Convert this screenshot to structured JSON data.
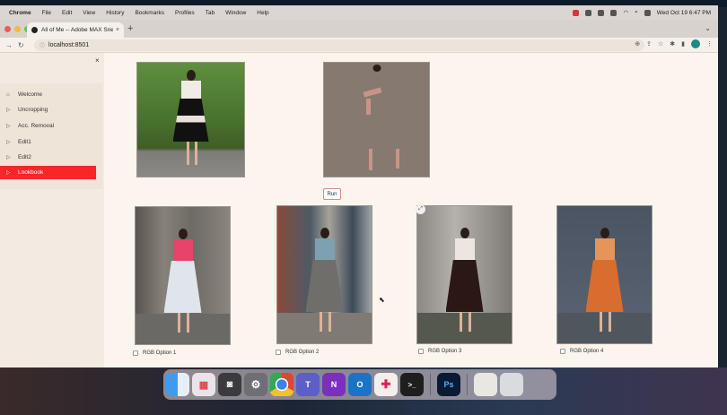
{
  "menubar": {
    "app_name": "Chrome",
    "items": [
      "File",
      "Edit",
      "View",
      "History",
      "Bookmarks",
      "Profiles",
      "Tab",
      "Window",
      "Help"
    ],
    "clock": "Wed Oct 19  6:47 PM"
  },
  "browser": {
    "tab_title": "All of Me -- Adobe MAX Snea",
    "new_tab": "+",
    "url": "localhost:8501"
  },
  "sidebar": {
    "close": "×",
    "items": [
      {
        "label": "Welcome",
        "icon": "home-icon"
      },
      {
        "label": "Uncropping",
        "icon": "triangle-right-icon"
      },
      {
        "label": "Acc. Removal",
        "icon": "triangle-right-icon"
      },
      {
        "label": "Edit1",
        "icon": "triangle-right-icon"
      },
      {
        "label": "Edit2",
        "icon": "triangle-right-icon"
      },
      {
        "label": "Lookbook",
        "icon": "triangle-right-icon",
        "active": true
      }
    ]
  },
  "main": {
    "run_button": "Run",
    "options": [
      {
        "label": "RGB Option 1",
        "checked": false
      },
      {
        "label": "RGB Option 2",
        "checked": false
      },
      {
        "label": "RGB Option 3",
        "checked": false
      },
      {
        "label": "RGB Option 4",
        "checked": false
      }
    ]
  },
  "dock": {
    "apps": [
      "Finder",
      "Launchpad",
      "Screenshot",
      "Settings",
      "Chrome",
      "Teams",
      "OneNote",
      "Outlook",
      "Slack",
      "Terminal",
      "Photoshop",
      "Preview",
      "Trash"
    ],
    "photoshop_label": "Ps",
    "onenote_label": "N",
    "outlook_label": "O",
    "teams_label": "T"
  },
  "colors": {
    "accent": "#f82626",
    "page_bg": "#fbf5ee",
    "sidebar_bg": "#f3ebe1",
    "outfit_1": "#e8436a",
    "outfit_2": "#6f6e6a",
    "outfit_3": "#2b1815",
    "outfit_4": "#d86e2e"
  }
}
